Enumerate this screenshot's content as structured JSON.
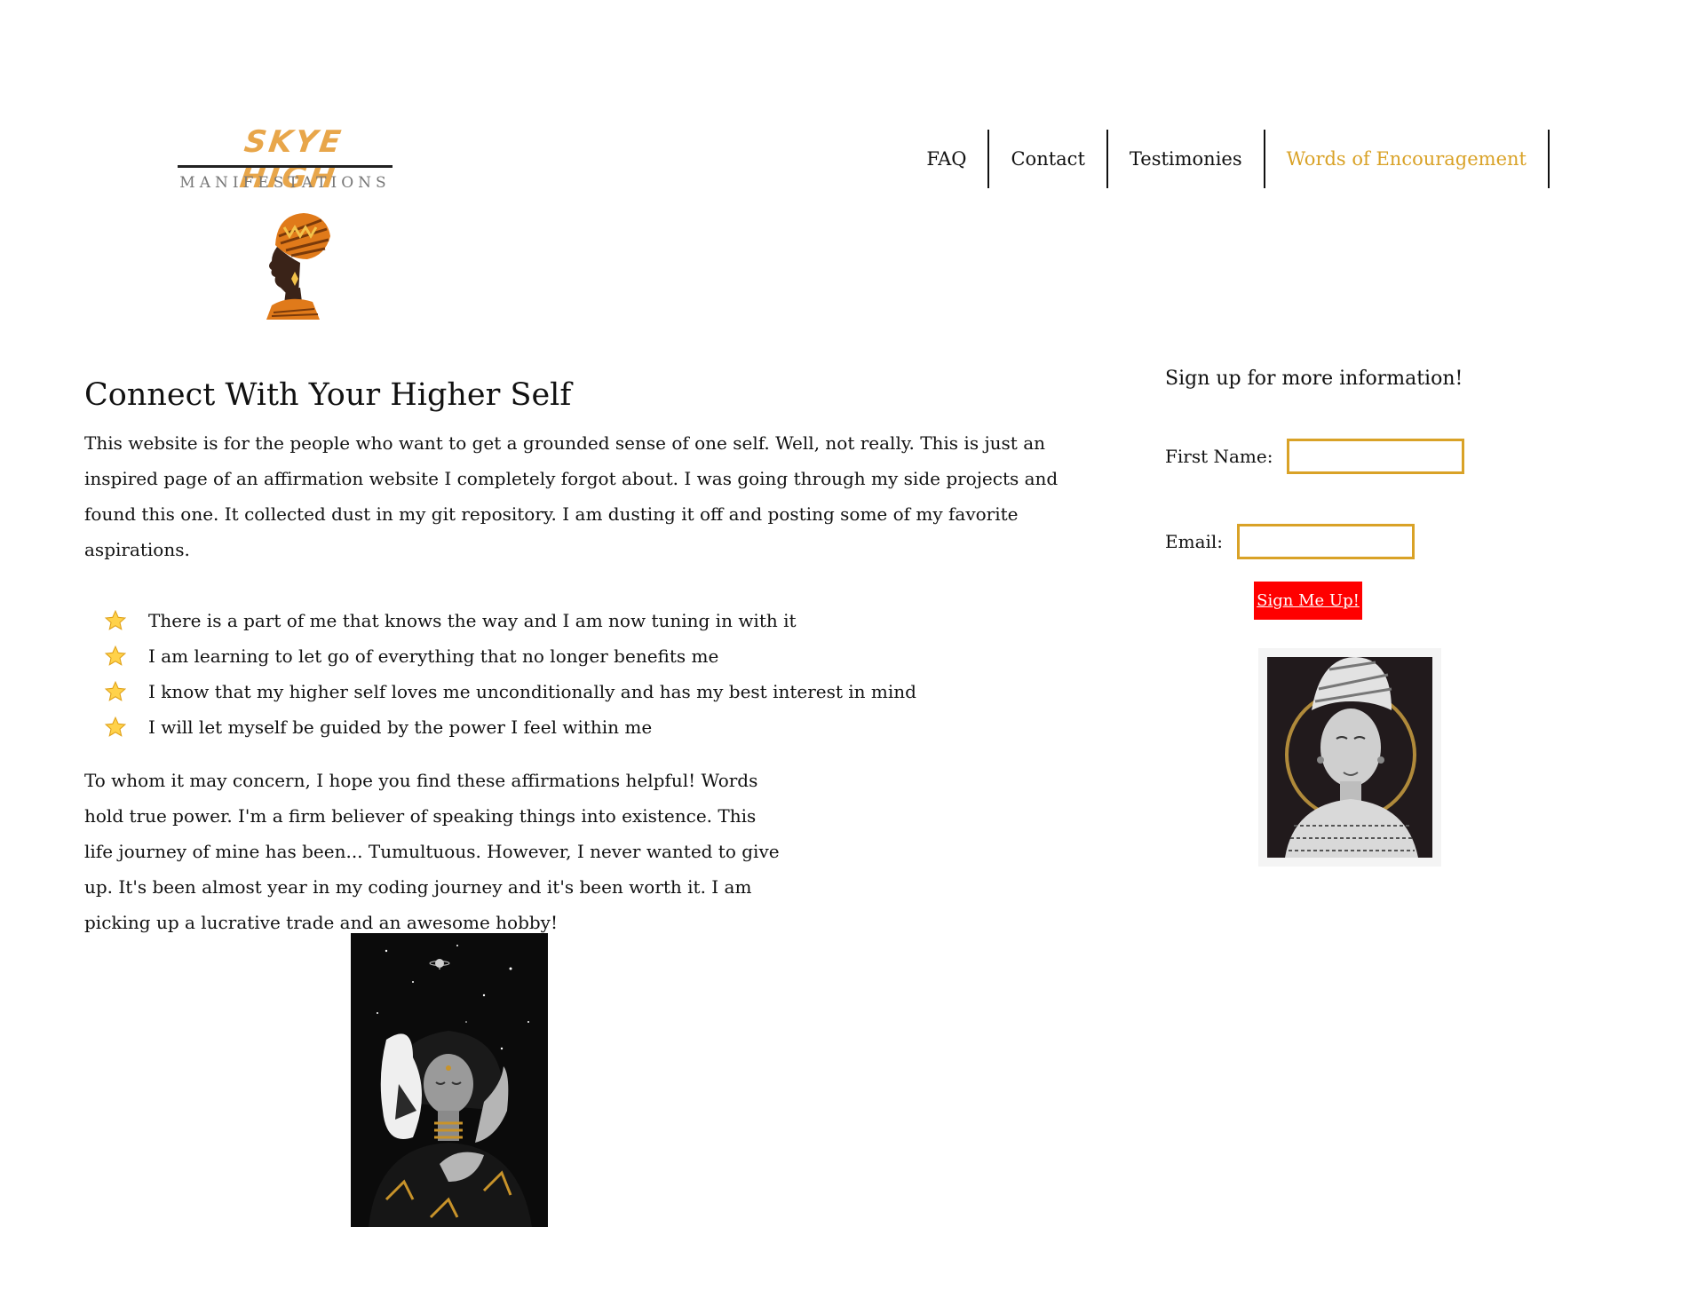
{
  "logo": {
    "script_text": "SKYE HIGH",
    "sub_text": "MANIFESTATIONS",
    "colors": {
      "script": "#e8a64a",
      "sub": "#777777"
    }
  },
  "nav": {
    "items": [
      {
        "label": "FAQ",
        "active": false
      },
      {
        "label": "Contact",
        "active": false
      },
      {
        "label": "Testimonies",
        "active": false
      },
      {
        "label": "Words of Encouragement",
        "active": true
      }
    ],
    "active_color": "#d9a227"
  },
  "main": {
    "title": "Connect With Your Higher Self",
    "intro": "This website is for the people who want to get a grounded sense of one self. Well, not really. This is just an inspired page of an affirmation website I completely forgot about. I was going through my side projects and found this one. It collected dust in my git repository. I am dusting it off and posting some of my favorite aspirations.",
    "affirmations": [
      "There is a part of me that knows the way and I am now tuning in with it",
      "I am learning to let go of everything that no longer benefits me",
      "I know that my higher self loves me unconditionally and has my best interest in mind",
      "I will let myself be guided by the power I feel within me"
    ],
    "list_icon": "star-icon",
    "closing": "To whom it may concern, I hope you find these affirmations helpful! Words hold true power. I'm a firm believer of speaking things into existence. This life journey of mine has been... Tumultuous. However, I never wanted to give up. It's been almost year in my coding journey and it's been worth it. I am picking up a lucrative trade and an awesome hobby!"
  },
  "sidebar": {
    "heading": "Sign up for more information!",
    "first_name_label": "First Name:",
    "first_name_value": "",
    "email_label": "Email:",
    "email_value": "",
    "button_label": "Sign Me Up!",
    "colors": {
      "field_border": "#d9a227",
      "button_bg": "#ff0000"
    }
  }
}
